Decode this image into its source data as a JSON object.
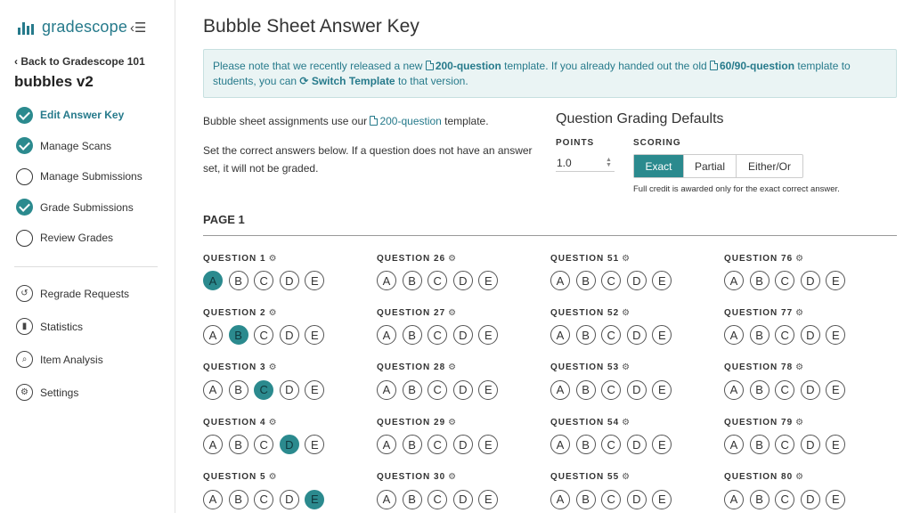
{
  "brand": {
    "name": "gradescope"
  },
  "sidebar": {
    "back_label": "Back to Gradescope 101",
    "course_title": "bubbles v2",
    "steps": [
      {
        "label": "Edit Answer Key",
        "done": true,
        "active": true
      },
      {
        "label": "Manage Scans",
        "done": true,
        "active": false
      },
      {
        "label": "Manage Submissions",
        "done": false,
        "active": false
      },
      {
        "label": "Grade Submissions",
        "done": true,
        "active": false
      },
      {
        "label": "Review Grades",
        "done": false,
        "active": false
      }
    ],
    "tools": [
      {
        "label": "Regrade Requests",
        "icon": "regrade-icon"
      },
      {
        "label": "Statistics",
        "icon": "statistics-icon"
      },
      {
        "label": "Item Analysis",
        "icon": "item-analysis-icon"
      },
      {
        "label": "Settings",
        "icon": "settings-icon"
      }
    ]
  },
  "main": {
    "title": "Bubble Sheet Answer Key",
    "notice": {
      "t1": "Please note that we recently released a new ",
      "link1": "200-question",
      "t2": " template. If you already handed out the old ",
      "link2": "60/90-question",
      "t3": " template to students, you can ",
      "link3": "Switch Template",
      "t4": " to that version."
    },
    "info1": {
      "pre": "Bubble sheet assignments use our ",
      "link": "200-question",
      "post": " template."
    },
    "info2": "Set the correct answers below. If a question does not have an answer set, it will not be graded.",
    "defaults": {
      "title": "Question Grading Defaults",
      "points_label": "POINTS",
      "points_value": "1.0",
      "scoring_label": "SCORING",
      "options": [
        "Exact",
        "Partial",
        "Either/Or"
      ],
      "selected": "Exact",
      "hint": "Full credit is awarded only for the exact correct answer."
    },
    "page_label": "PAGE 1",
    "choices": [
      "A",
      "B",
      "C",
      "D",
      "E"
    ],
    "questions": [
      {
        "label": "QUESTION 1",
        "answer": "A"
      },
      {
        "label": "QUESTION 26",
        "answer": ""
      },
      {
        "label": "QUESTION 51",
        "answer": ""
      },
      {
        "label": "QUESTION 76",
        "answer": ""
      },
      {
        "label": "QUESTION 2",
        "answer": "B"
      },
      {
        "label": "QUESTION 27",
        "answer": ""
      },
      {
        "label": "QUESTION 52",
        "answer": ""
      },
      {
        "label": "QUESTION 77",
        "answer": ""
      },
      {
        "label": "QUESTION 3",
        "answer": "C"
      },
      {
        "label": "QUESTION 28",
        "answer": ""
      },
      {
        "label": "QUESTION 53",
        "answer": ""
      },
      {
        "label": "QUESTION 78",
        "answer": ""
      },
      {
        "label": "QUESTION 4",
        "answer": "D"
      },
      {
        "label": "QUESTION 29",
        "answer": ""
      },
      {
        "label": "QUESTION 54",
        "answer": ""
      },
      {
        "label": "QUESTION 79",
        "answer": ""
      },
      {
        "label": "QUESTION 5",
        "answer": "E"
      },
      {
        "label": "QUESTION 30",
        "answer": ""
      },
      {
        "label": "QUESTION 55",
        "answer": ""
      },
      {
        "label": "QUESTION 80",
        "answer": ""
      }
    ]
  },
  "colors": {
    "accent": "#267a8b",
    "selected": "#2b8a8e",
    "notice_bg": "#eaf4f4"
  }
}
